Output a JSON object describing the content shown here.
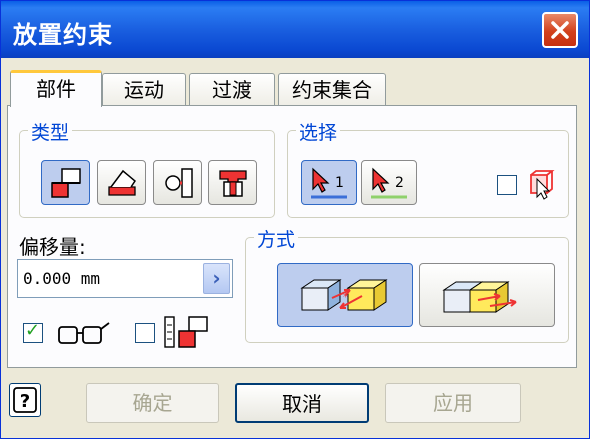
{
  "window": {
    "title": "放置约束",
    "close_label": "关闭"
  },
  "tabs": [
    {
      "label": "部件",
      "active": true
    },
    {
      "label": "运动"
    },
    {
      "label": "过渡"
    },
    {
      "label": "约束集合"
    }
  ],
  "type_group": {
    "label": "类型",
    "buttons": [
      "mate-icon",
      "angle-icon",
      "tangent-icon",
      "insert-icon"
    ],
    "selected": "mate-icon"
  },
  "select_group": {
    "label": "选择",
    "first": "1",
    "second": "2",
    "first_color": "#3b6fd8",
    "second_color": "#8fd16b"
  },
  "offset": {
    "label": "偏移量:",
    "value": "0.000 mm"
  },
  "method_group": {
    "label": "方式",
    "options": [
      "mate-solution-icon",
      "flush-solution-icon"
    ],
    "selected": "mate-solution-icon"
  },
  "checkboxes": {
    "show_preview": true,
    "predict_offset": false
  },
  "buttons": {
    "ok": "确定",
    "cancel": "取消",
    "apply": "应用",
    "help": "?"
  },
  "colors": {
    "title_bar": "#0a5fe6",
    "accent": "#0046d5",
    "active_tab_highlight": "#ffc83c"
  }
}
